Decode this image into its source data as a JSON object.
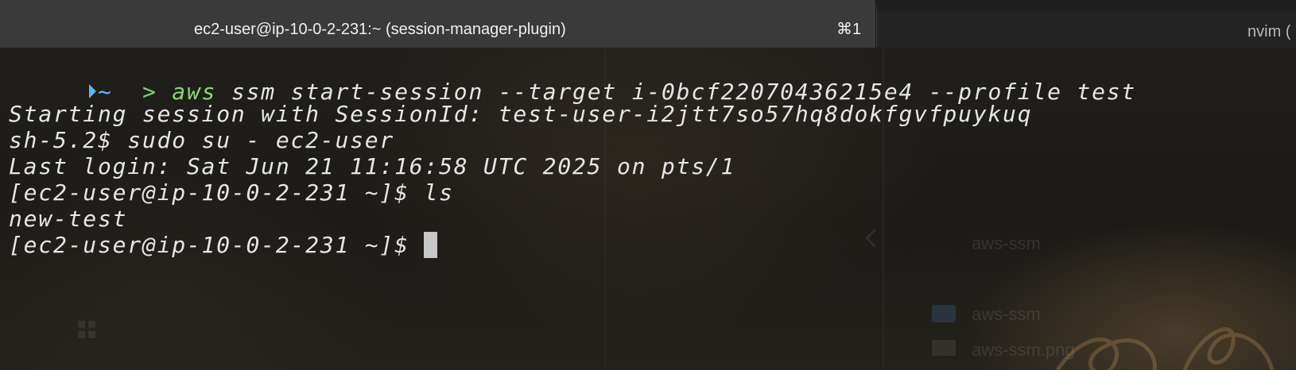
{
  "tabs": [
    {
      "title": "ec2-user@ip-10-0-2-231:~ (session-manager-plugin)",
      "shortcut": "⌘1",
      "active": true
    },
    {
      "title": "nvim (",
      "active": false
    }
  ],
  "terminal": {
    "prompt": {
      "dir": "~",
      "arrow": ">"
    },
    "command": {
      "name": "aws",
      "args": " ssm start-session --target i-0bcf22070436215e4 --profile test"
    },
    "output": [
      "Starting session with SessionId: test-user-i2jtt7so57hq8dokfgvfpuykuq",
      "sh-5.2$ sudo su - ec2-user",
      "Last login: Sat Jun 21 11:16:58 UTC 2025 on pts/1",
      "[ec2-user@ip-10-0-2-231 ~]$ ls",
      "new-test",
      "[ec2-user@ip-10-0-2-231 ~]$ "
    ]
  },
  "background_window": {
    "title": "aws-ssm",
    "items": [
      "aws-ssm",
      "aws-ssm.png"
    ]
  },
  "colors": {
    "command": "#8ad47a",
    "prompt_dir": "#6eb6ff",
    "prompt_arrow": "#7ed07e",
    "cursor": "#c8c8c8"
  }
}
